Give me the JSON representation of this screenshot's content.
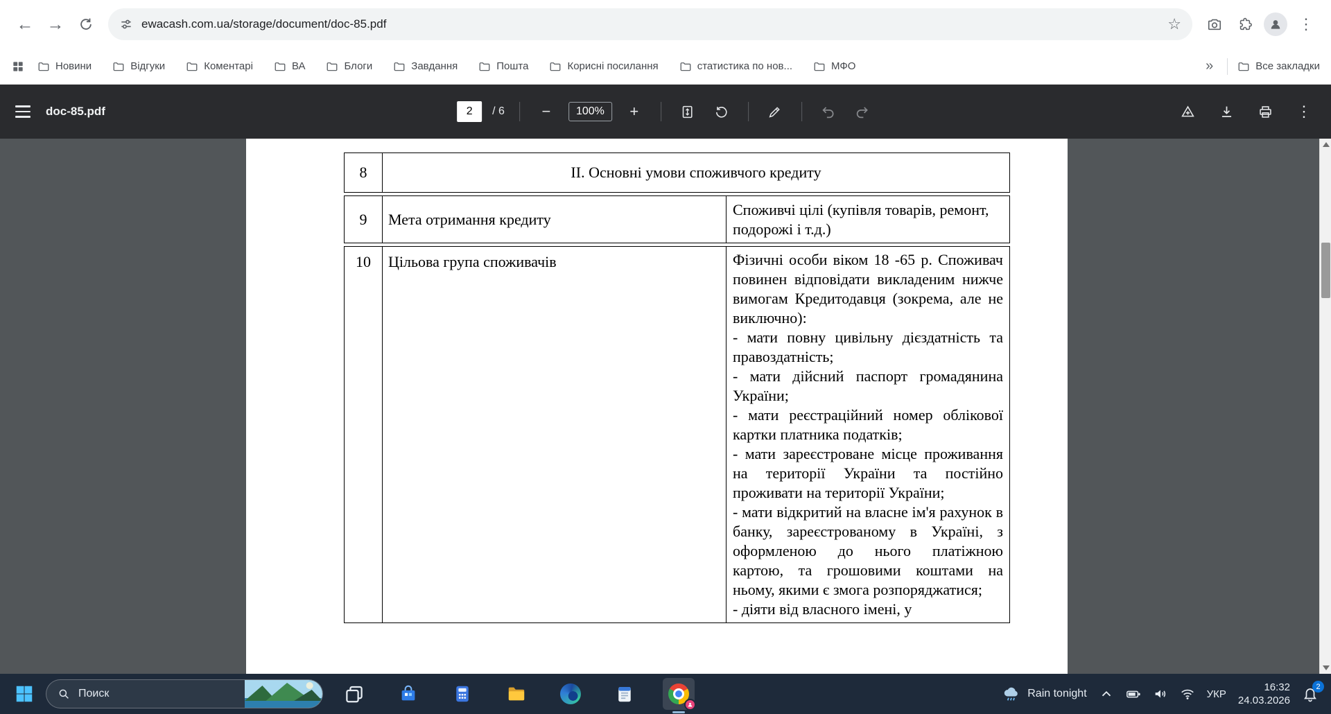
{
  "browser": {
    "url": "ewacash.com.ua/storage/document/doc-85.pdf",
    "bookmarks_bar": {
      "items": [
        "Новини",
        "Відгуки",
        "Коментарі",
        "ВА",
        "Блоги",
        "Завдання",
        "Пошта",
        "Корисні посилання",
        "статистика по нов...",
        "МФО"
      ],
      "overflow": "»",
      "all_bookmarks": "Все закладки"
    }
  },
  "pdf_viewer": {
    "filename": "doc-85.pdf",
    "page_current": "2",
    "page_count_label": "/ 6",
    "zoom_level": "100%"
  },
  "document_table": {
    "rows": [
      {
        "num": "8",
        "header": "ІІ. Основні умови споживчого кредиту"
      },
      {
        "num": "9",
        "label": "Мета отримання кредиту",
        "paragraphs": [
          "Споживчі цілі (купівля товарів, ремонт, подорожі і т.д.)"
        ]
      },
      {
        "num": "10",
        "label": "Цільова група споживачів",
        "paragraphs": [
          "Фізичні особи віком 18 -65 р. Споживач повинен відповідати викладеним нижче вимогам Кредитодавця (зокрема, але не виключно):",
          "- мати повну цивільну дієздатність та правоздатність;",
          "- мати дійсний паспорт громадянина України;",
          "- мати реєстраційний номер облікової картки платника податків;",
          "- мати зареєстроване місце проживання на території України та постійно проживати на території України;",
          "- мати відкритий на власне ім'я рахунок в банку, зареєстрованому в Україні, з оформленою до нього платіжною картою, та грошовими коштами на ньому, якими є змога розпоряджатися;",
          "- діяти від власного імені, у"
        ]
      }
    ]
  },
  "taskbar": {
    "search_placeholder": "Поиск",
    "weather_status": "Rain tonight",
    "language": "УКР",
    "time": "16:32",
    "date": "24.03.2026",
    "notification_count": "2",
    "apps": [
      "task-view",
      "microsoft-store",
      "calculator",
      "file-explorer",
      "edge",
      "notepad",
      "chrome"
    ]
  },
  "icons": {
    "back": "←",
    "forward": "→",
    "minus": "−",
    "plus": "+",
    "kebab": "⋮",
    "star": "☆",
    "overflow": "»"
  }
}
